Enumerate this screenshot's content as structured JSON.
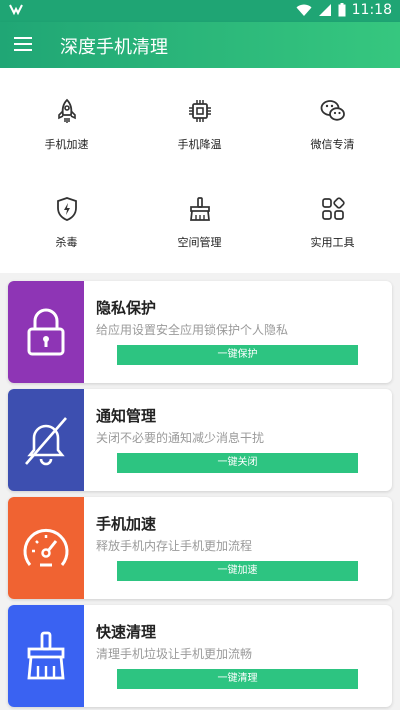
{
  "status": {
    "time": "11:18"
  },
  "toolbar": {
    "title": "深度手机清理"
  },
  "grid": [
    {
      "label": "手机加速",
      "icon": "rocket-icon"
    },
    {
      "label": "手机降温",
      "icon": "chip-icon"
    },
    {
      "label": "微信专清",
      "icon": "wechat-icon"
    },
    {
      "label": "杀毒",
      "icon": "shield-icon"
    },
    {
      "label": "空间管理",
      "icon": "broom-icon"
    },
    {
      "label": "实用工具",
      "icon": "apps-icon"
    }
  ],
  "cards": [
    {
      "title": "隐私保护",
      "desc": "给应用设置安全应用锁保护个人隐私",
      "button": "一键保护",
      "color": "#8e35b5",
      "icon": "lock-icon"
    },
    {
      "title": "通知管理",
      "desc": "关闭不必要的通知减少消息干扰",
      "button": "一键关闭",
      "color": "#3d4fb0",
      "icon": "bell-off-icon"
    },
    {
      "title": "手机加速",
      "desc": "释放手机内存让手机更加流程",
      "button": "一键加速",
      "color": "#f06332",
      "icon": "speedometer-icon"
    },
    {
      "title": "快速清理",
      "desc": "清理手机垃圾让手机更加流畅",
      "button": "一键清理",
      "color": "#3a62f2",
      "icon": "broom-icon"
    }
  ]
}
